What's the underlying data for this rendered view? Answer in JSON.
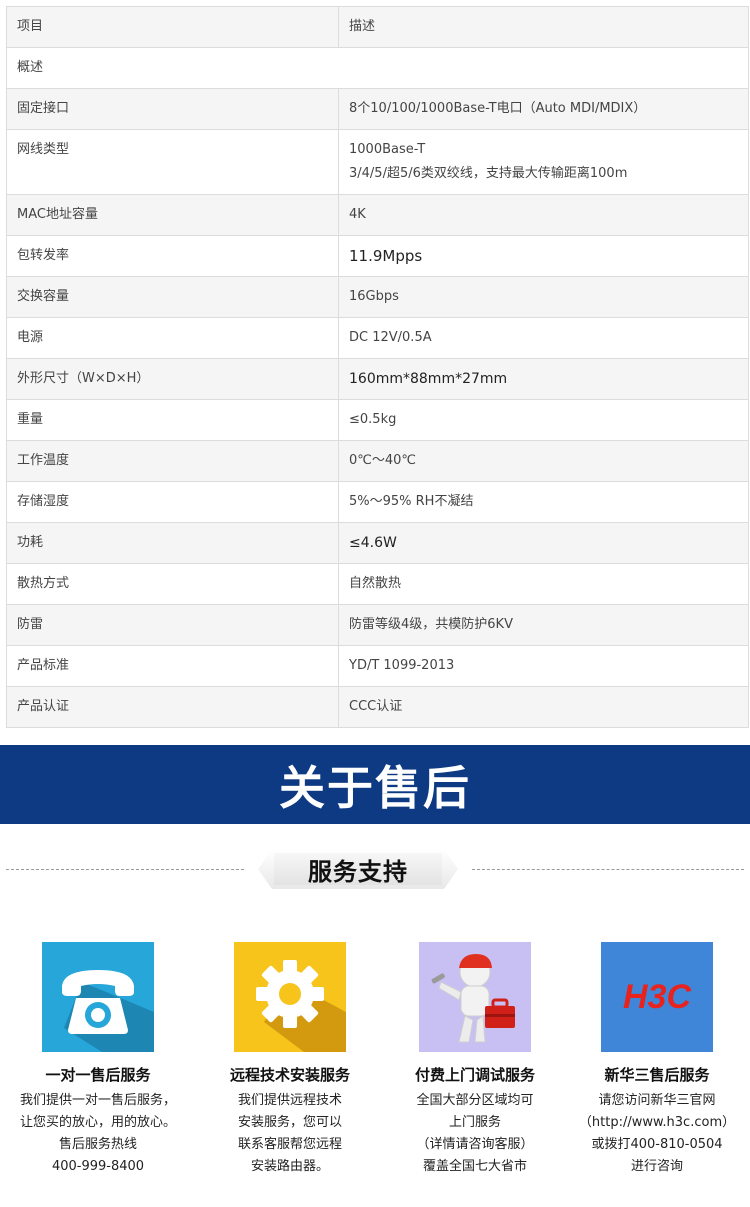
{
  "spec_table": {
    "header": {
      "col1": "项目",
      "col2": "描述"
    },
    "overview_label": "概述",
    "rows": [
      {
        "label": "固定接口",
        "value": "8个10/100/1000Base-T电口（Auto MDI/MDIX）"
      },
      {
        "label": "网线类型",
        "value": "1000Base-T",
        "value2": "3/4/5/超5/6类双绞线，支持最大传输距离100m"
      },
      {
        "label": "MAC地址容量",
        "value": "4K"
      },
      {
        "label": "包转发率",
        "value": "11.9Mpps"
      },
      {
        "label": "交换容量",
        "value": "16Gbps"
      },
      {
        "label": "电源",
        "value": "DC 12V/0.5A"
      },
      {
        "label": "外形尺寸（W×D×H）",
        "value": "160mm*88mm*27mm"
      },
      {
        "label": "重量",
        "value": "≤0.5kg"
      },
      {
        "label": "工作温度",
        "value": "0℃～40℃"
      },
      {
        "label": "存储湿度",
        "value": "5%～95% RH不凝结"
      },
      {
        "label": "功耗",
        "value": "≤4.6W"
      },
      {
        "label": "散热方式",
        "value": "自然散热"
      },
      {
        "label": "防雷",
        "value": "防雷等级4级，共模防护6KV"
      },
      {
        "label": "产品标准",
        "value": "YD/T 1099-2013"
      },
      {
        "label": "产品认证",
        "value": "CCC认证"
      }
    ]
  },
  "banner": {
    "title": "关于售后",
    "color": "#0d3a82"
  },
  "service_section": {
    "title": "服务支持"
  },
  "services": [
    {
      "icon": "phone-icon",
      "title": "一对一售后服务",
      "lines": [
        "我们提供一对一售后服务，",
        "让您买的放心，用的放心。",
        "售后服务热线",
        "400-999-8400"
      ]
    },
    {
      "icon": "gear-icon",
      "title": "远程技术安装服务",
      "lines": [
        "我们提供远程技术",
        "安装服务，您可以",
        "联系客服帮您远程",
        "安装路由器。"
      ]
    },
    {
      "icon": "repair-person-icon",
      "title": "付费上门调试服务",
      "lines": [
        "全国大部分区域均可",
        "上门服务",
        "（详情请咨询客服）",
        "覆盖全国七大省市"
      ]
    },
    {
      "icon": "h3c-logo",
      "logo_text": "H3C",
      "title": "新华三售后服务",
      "lines": [
        "请您访问新华三官网",
        "（http://www.h3c.com）",
        "或拨打400-810-0504",
        "进行咨询"
      ]
    }
  ]
}
